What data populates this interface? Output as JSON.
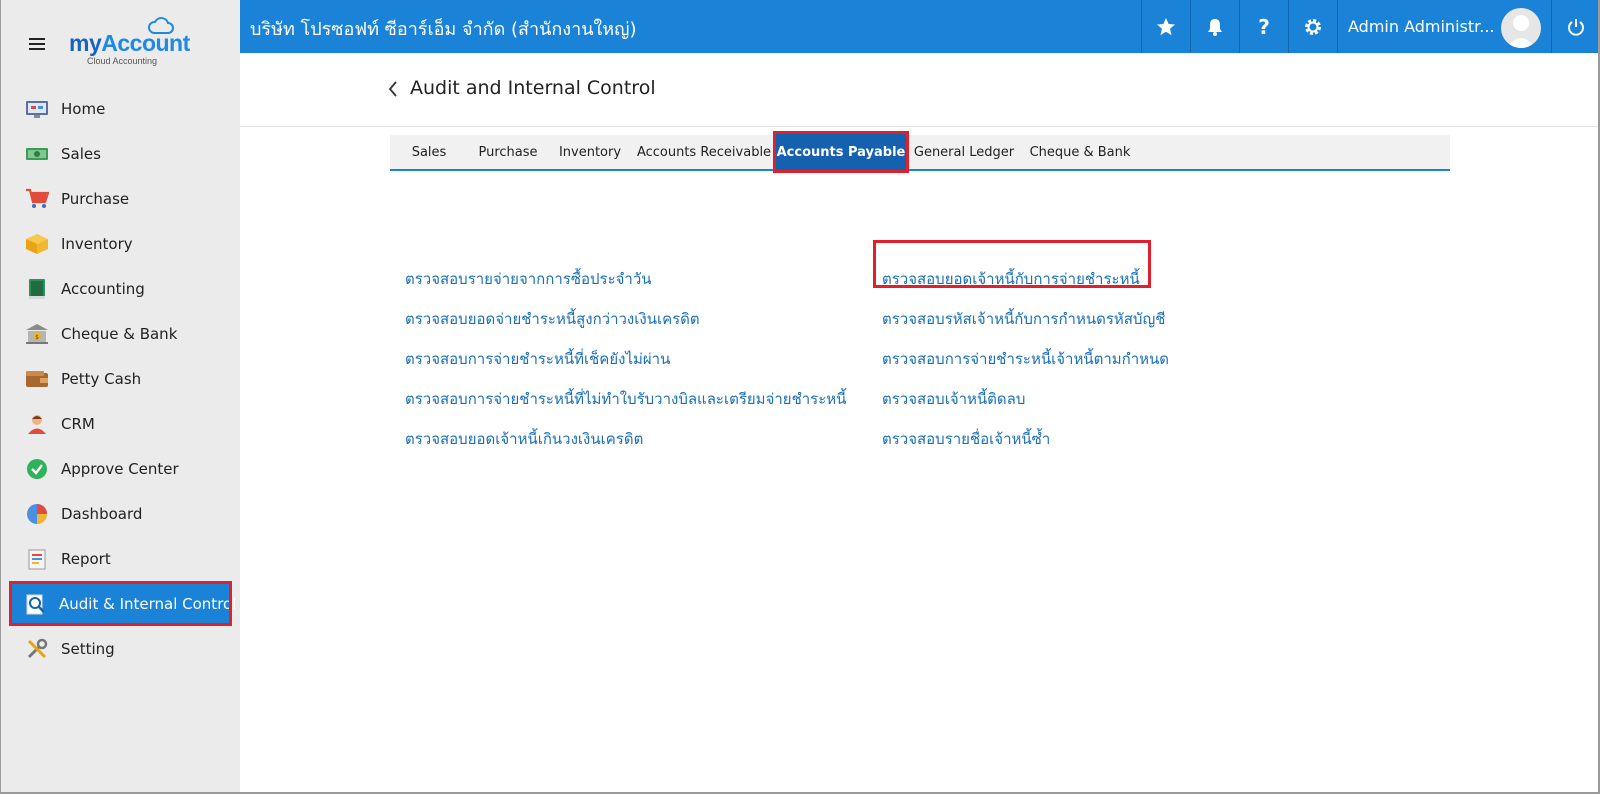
{
  "logo": {
    "brand_my": "my",
    "brand_account": "Account",
    "subtitle": "Cloud Accounting"
  },
  "sidebar": {
    "items": [
      {
        "label": "Home",
        "icon": "home-icon"
      },
      {
        "label": "Sales",
        "icon": "sales-icon"
      },
      {
        "label": "Purchase",
        "icon": "cart-icon"
      },
      {
        "label": "Inventory",
        "icon": "box-icon"
      },
      {
        "label": "Accounting",
        "icon": "book-icon"
      },
      {
        "label": "Cheque & Bank",
        "icon": "bank-icon"
      },
      {
        "label": "Petty Cash",
        "icon": "wallet-icon"
      },
      {
        "label": "CRM",
        "icon": "person-icon"
      },
      {
        "label": "Approve Center",
        "icon": "check-circle-icon"
      },
      {
        "label": "Dashboard",
        "icon": "pie-chart-icon"
      },
      {
        "label": "Report",
        "icon": "report-icon"
      },
      {
        "label": "Audit & Internal Control",
        "icon": "audit-icon"
      },
      {
        "label": "Setting",
        "icon": "tools-icon"
      }
    ],
    "active": "Audit & Internal Control"
  },
  "topbar": {
    "company": "บริษัท โปรซอฟท์ ซีอาร์เอ็ม จำกัด (สำนักงานใหญ่)",
    "user": "Admin Administr..."
  },
  "page": {
    "title": "Audit and Internal Control"
  },
  "tabs": [
    {
      "label": "Sales"
    },
    {
      "label": "Purchase"
    },
    {
      "label": "Inventory"
    },
    {
      "label": "Accounts Receivable"
    },
    {
      "label": "Accounts Payable"
    },
    {
      "label": "General Ledger"
    },
    {
      "label": "Cheque & Bank"
    }
  ],
  "active_tab": "Accounts Payable",
  "links": {
    "left": [
      "ตรวจสอบรายจ่ายจากการซื้อประจำวัน",
      "ตรวจสอบยอดจ่ายชำระหนี้สูงกว่าวงเงินเครดิต",
      "ตรวจสอบการจ่ายชำระหนี้ที่เช็คยังไม่ผ่าน",
      "ตรวจสอบการจ่ายชำระหนี้ที่ไม่ทำใบรับวางบิลและเตรียมจ่ายชำระหนี้",
      "ตรวจสอบยอดเจ้าหนี้เกินวงเงินเครดิต"
    ],
    "right": [
      "ตรวจสอบยอดเจ้าหนี้กับการจ่ายชำระหนี้",
      "ตรวจสอบรหัสเจ้าหนี้กับการกำหนดรหัสบัญชี",
      "ตรวจสอบการจ่ายชำระหนี้เจ้าหนี้ตามกำหนด",
      "ตรวจสอบเจ้าหนี้ติดลบ",
      "ตรวจสอบรายชื่อเจ้าหนี้ซ้ำ"
    ]
  },
  "colors": {
    "primary": "#1a83d8",
    "tab_active": "#1561b0",
    "link": "#1a6fb8",
    "highlight": "#e0202a"
  }
}
